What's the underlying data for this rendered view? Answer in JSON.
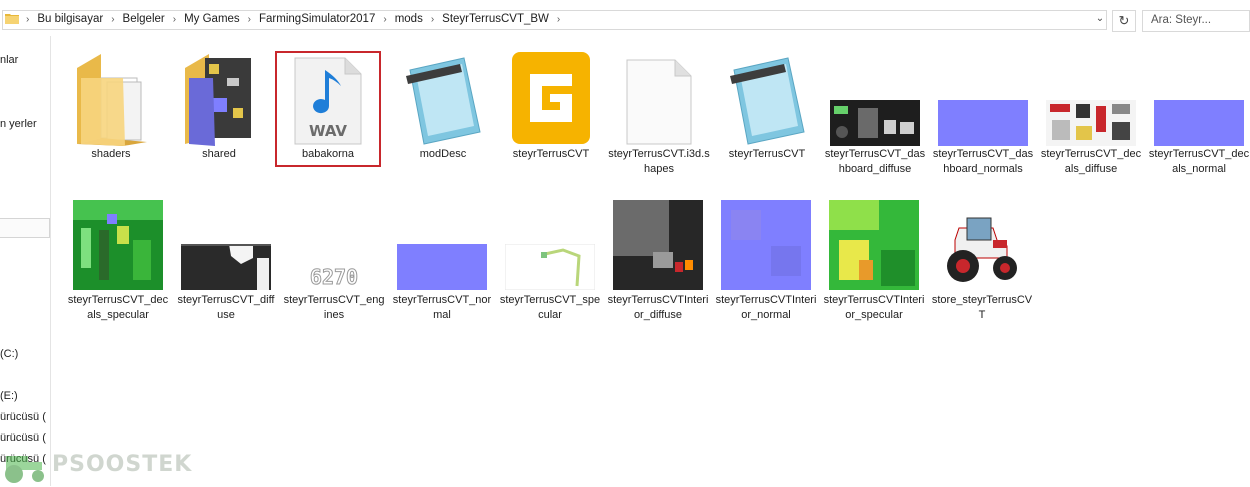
{
  "address": {
    "crumbs": [
      "Bu bilgisayar",
      "Belgeler",
      "My Games",
      "FarmingSimulator2017",
      "mods",
      "SteyrTerrusCVT_BW"
    ],
    "search_placeholder": "Ara: Steyr..."
  },
  "nav": {
    "items": [
      "nlar",
      "n yerler",
      "(C:)",
      "(E:)",
      "ürücüsü (",
      "ürücüsü (",
      "ürücüsü ("
    ]
  },
  "files": [
    {
      "name": "shaders",
      "icon": "folder-icon"
    },
    {
      "name": "shared",
      "icon": "folder-icon"
    },
    {
      "name": "babakorna",
      "icon": "wav-file-icon"
    },
    {
      "name": "modDesc",
      "icon": "notepad-icon"
    },
    {
      "name": "steyrTerrusCVT",
      "icon": "giants-editor-icon"
    },
    {
      "name": "steyrTerrusCVT.i3d.shapes",
      "icon": "blank-file-icon"
    },
    {
      "name": "steyrTerrusCVT",
      "icon": "notepad-icon"
    },
    {
      "name": "steyrTerrusCVT_dashboard_diffuse",
      "icon": "texture-thumbnail"
    },
    {
      "name": "steyrTerrusCVT_dashboard_normals",
      "icon": "texture-thumbnail"
    },
    {
      "name": "steyrTerrusCVT_decals_diffuse",
      "icon": "texture-thumbnail"
    },
    {
      "name": "steyrTerrusCVT_decals_normal",
      "icon": "texture-thumbnail"
    },
    {
      "name": "steyrTerrusCVT_decals_specular",
      "icon": "texture-thumbnail"
    },
    {
      "name": "steyrTerrusCVT_diffuse",
      "icon": "texture-thumbnail"
    },
    {
      "name": "steyrTerrusCVT_engines",
      "icon": "texture-thumbnail"
    },
    {
      "name": "steyrTerrusCVT_normal",
      "icon": "texture-thumbnail"
    },
    {
      "name": "steyrTerrusCVT_specular",
      "icon": "texture-thumbnail"
    },
    {
      "name": "steyrTerrusCVTInterior_diffuse",
      "icon": "texture-thumbnail"
    },
    {
      "name": "steyrTerrusCVTInterior_normal",
      "icon": "texture-thumbnail"
    },
    {
      "name": "steyrTerrusCVTInterior_specular",
      "icon": "texture-thumbnail"
    },
    {
      "name": "store_steyrTerrusCVT",
      "icon": "tractor-image"
    }
  ],
  "wav_label": "WAV",
  "engines_label": "6270",
  "watermark": "PSOOSTEK",
  "colors": {
    "selection": "#c8272c",
    "normal_map": "#7f7fff",
    "folder": "#f4d27a"
  }
}
